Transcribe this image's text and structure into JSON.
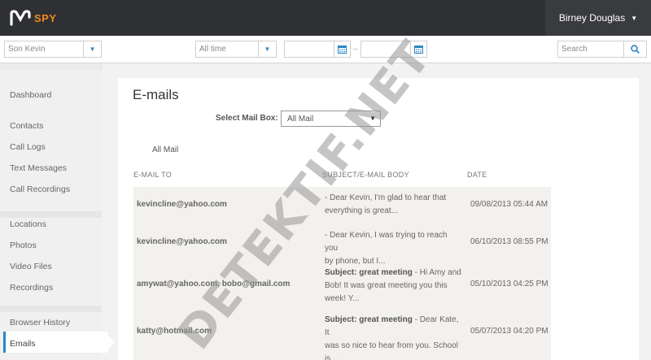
{
  "header": {
    "brand": "SPY",
    "user_name": "Birney Douglas",
    "caret_icon": "caret-down-icon"
  },
  "filters": {
    "device": "Son Kevin",
    "period": "All time",
    "date_from": "",
    "date_separator": "–",
    "date_to": "",
    "search_placeholder": "Search"
  },
  "sidebar": {
    "items": [
      {
        "label": "Dashboard"
      },
      {
        "label": "Contacts"
      },
      {
        "label": "Call Logs"
      },
      {
        "label": "Text Messages"
      },
      {
        "label": "Call Recordings"
      },
      {
        "label": "Locations"
      },
      {
        "label": "Photos"
      },
      {
        "label": "Video Files"
      },
      {
        "label": "Recordings"
      },
      {
        "label": "Browser History"
      },
      {
        "label": "Emails"
      }
    ],
    "active": "Emails"
  },
  "main": {
    "title": "E-mails",
    "mailbox_label": "Select Mail Box:",
    "mailbox_value": "All Mail",
    "section_label": "All Mail",
    "columns": [
      "E-MAIL TO",
      "SUBJECT/E-MAIL BODY",
      "DATE"
    ],
    "rows": [
      {
        "to": "kevincline@yahoo.com",
        "subject": "",
        "body_line1": "- Dear Kevin, I'm glad to hear that",
        "body_line2": "everything is great...",
        "date": "09/08/2013 05:44 AM"
      },
      {
        "to": "kevincline@yahoo.com",
        "subject": "",
        "body_line1": "- Dear Kevin, I was trying to reach you",
        "body_line2": "by phone, but I...",
        "date": "06/10/2013 08:55 PM"
      },
      {
        "to": "amywat@yahoo.com, bobo@gmail.com",
        "subject": "Subject: great meeting",
        "body_line1": " - Hi Amy and",
        "body_line2": "Bob! It was great meeting you this",
        "body_line3": "week! Y...",
        "date": "05/10/2013 04:25 PM"
      },
      {
        "to": "katty@hotmail.com",
        "subject": "Subject: great meeting",
        "body_line1": " - Dear Kate, It",
        "body_line2": "was so nice to hear from you. School",
        "body_line3": "is...",
        "date": "05/07/2013 04:20 PM"
      }
    ]
  },
  "watermark": "DETEKTIF.NET",
  "colors": {
    "topbar": "#2f3033",
    "brand": "#f08a1c",
    "accent": "#2a86c7"
  }
}
